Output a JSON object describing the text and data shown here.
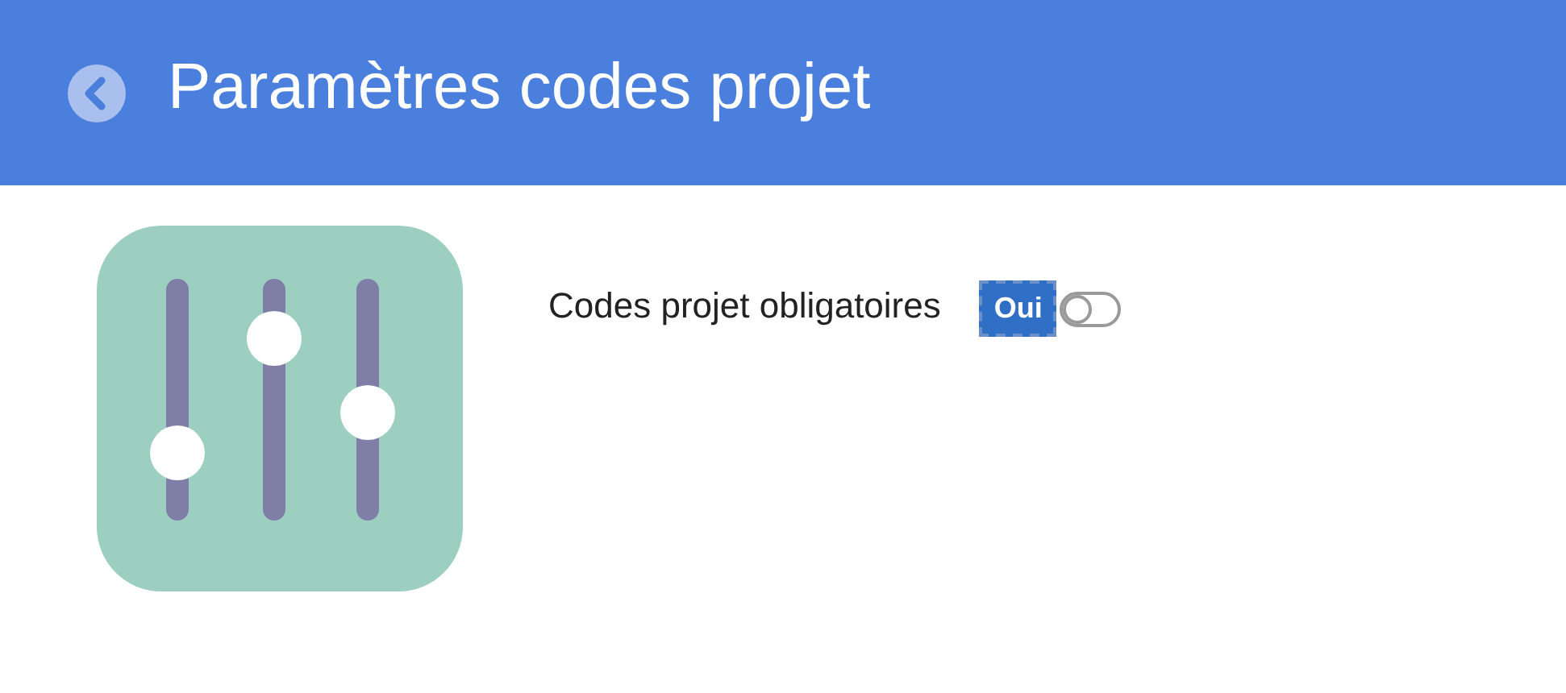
{
  "header": {
    "title": "Paramètres codes projet"
  },
  "settings": [
    {
      "label": "Codes projet obligatoires",
      "value_label": "Oui",
      "on": false
    }
  ]
}
